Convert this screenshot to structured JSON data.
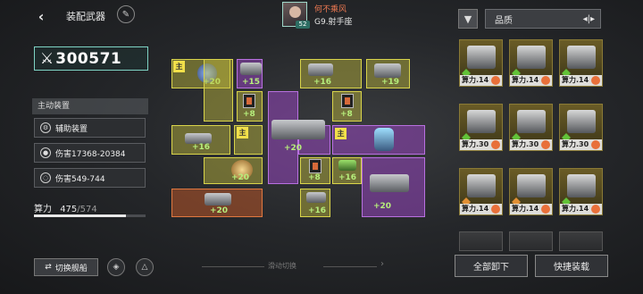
{
  "header": {
    "title": "装配武器",
    "back_icon": "back-arrow-icon",
    "edit_icon": "brush-icon"
  },
  "player": {
    "name": "何不乘风",
    "rank": "G9.射手座",
    "level": "52"
  },
  "power": {
    "value": "300571"
  },
  "active_equipment": {
    "heading": "主动装置",
    "items": [
      {
        "label": "辅助装置",
        "icon": "gear-icon"
      },
      {
        "label": "伤害17368-20384",
        "icon": "group-icon"
      },
      {
        "label": "伤害549-744",
        "icon": "shield-icon"
      }
    ]
  },
  "capacity": {
    "label": "算力",
    "used": "475",
    "sep": "/",
    "max": "574",
    "fraction": 0.8275
  },
  "main_badge": "主",
  "slots": [
    "+20",
    "+15",
    "+8",
    "+16",
    "+20",
    "+20",
    "+20",
    "+8",
    "+19",
    "+16",
    "+8",
    "+16",
    "+20"
  ],
  "filter": {
    "label": "品质"
  },
  "inventory": [
    {
      "cost": "算力.14",
      "grade": "green"
    },
    {
      "cost": "算力.14",
      "grade": "green"
    },
    {
      "cost": "算力.14",
      "grade": "green"
    },
    {
      "cost": "算力.30",
      "grade": "green"
    },
    {
      "cost": "算力.30",
      "grade": "green"
    },
    {
      "cost": "算力.30",
      "grade": "green"
    },
    {
      "cost": "算力.14",
      "grade": "orange"
    },
    {
      "cost": "算力.14",
      "grade": "orange"
    },
    {
      "cost": "算力.14",
      "grade": "green"
    }
  ],
  "bottom": {
    "switch_ship": "切换舰船",
    "swipe_hint": "滑动切换",
    "unload_all": "全部卸下",
    "quick_equip": "快捷装载"
  }
}
